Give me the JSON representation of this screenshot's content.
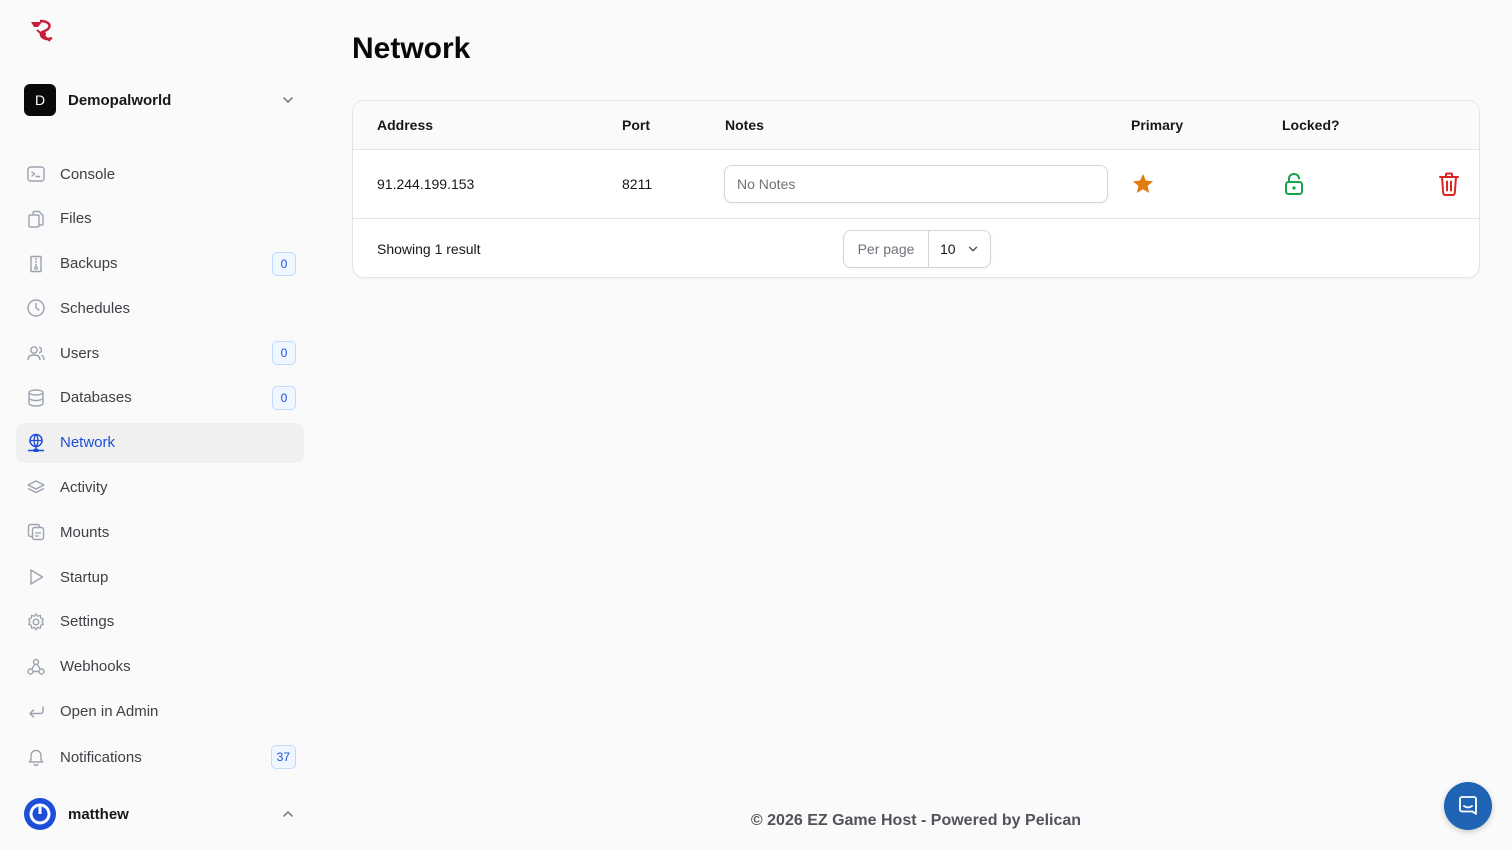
{
  "app": {
    "server_initial": "D",
    "server_name": "Demopalworld"
  },
  "sidebar": {
    "items": [
      {
        "label": "Console",
        "icon": "terminal-icon"
      },
      {
        "label": "Files",
        "icon": "files-icon"
      },
      {
        "label": "Backups",
        "icon": "archive-icon",
        "badge": "0"
      },
      {
        "label": "Schedules",
        "icon": "clock-icon"
      },
      {
        "label": "Users",
        "icon": "users-icon",
        "badge": "0"
      },
      {
        "label": "Databases",
        "icon": "database-icon",
        "badge": "0"
      },
      {
        "label": "Network",
        "icon": "network-icon",
        "active": true
      },
      {
        "label": "Activity",
        "icon": "stack-icon"
      },
      {
        "label": "Mounts",
        "icon": "mounts-icon"
      },
      {
        "label": "Startup",
        "icon": "play-icon"
      },
      {
        "label": "Settings",
        "icon": "gear-icon"
      },
      {
        "label": "Webhooks",
        "icon": "webhook-icon"
      },
      {
        "label": "Open in Admin",
        "icon": "return-arrow-icon"
      }
    ],
    "notifications": {
      "label": "Notifications",
      "icon": "bell-icon",
      "badge": "37"
    },
    "user": {
      "name": "matthew"
    }
  },
  "page": {
    "title": "Network"
  },
  "table": {
    "columns": [
      "Address",
      "Port",
      "Notes",
      "Primary",
      "Locked?"
    ],
    "rows": [
      {
        "address": "91.244.199.153",
        "port": "8211",
        "notes_value": "",
        "notes_placeholder": "No Notes",
        "primary": true,
        "locked": false
      }
    ],
    "result_text": "Showing 1 result",
    "per_page_label": "Per page",
    "per_page_value": "10"
  },
  "footer": {
    "text": "© 2026 EZ Game Host - Powered by Pelican"
  },
  "colors": {
    "accent": "#1d4ed8",
    "primary_star": "#e07b10",
    "unlocked": "#16a34a",
    "delete": "#dc2626"
  }
}
